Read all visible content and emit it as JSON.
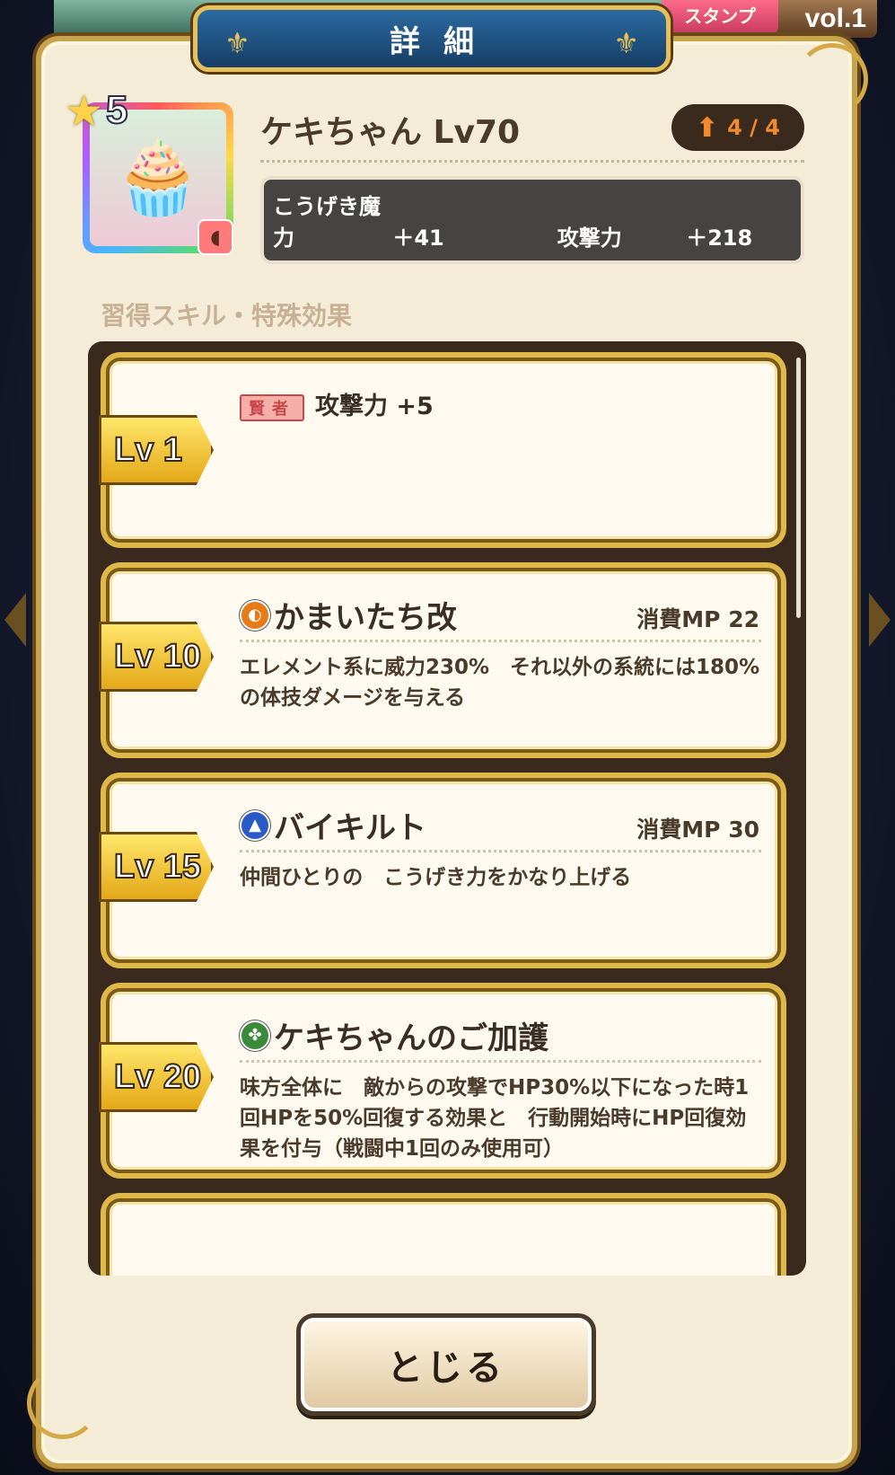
{
  "header": {
    "title": "詳細",
    "vol_label": "vol.",
    "vol_number": "1",
    "stamp_label": "スタンプ"
  },
  "monster": {
    "rank": "5",
    "name": "ケキちゃん Lv70",
    "upgrade_progress": "4 / 4",
    "stats": [
      {
        "label": "こうげき魔力",
        "value": "＋41"
      },
      {
        "label": "攻撃力",
        "value": "＋218"
      }
    ]
  },
  "section_title": "習得スキル・特殊効果",
  "skills": [
    {
      "level": "Lv 1",
      "tag": "賢者",
      "text": "攻撃力 +5"
    },
    {
      "level": "Lv 10",
      "icon": "fire-element-icon",
      "name": "かまいたち改",
      "mp": "消費MP  22",
      "description": "エレメント系に威力230%　それ以外の系統には180%の体技ダメージを与える"
    },
    {
      "level": "Lv 15",
      "icon": "buff-element-icon",
      "name": "バイキルト",
      "mp": "消費MP  30",
      "description": "仲間ひとりの　こうげき力をかなり上げる"
    },
    {
      "level": "Lv 20",
      "icon": "heal-element-icon",
      "name": "ケキちゃんのご加護",
      "mp": "",
      "description": "味方全体に　敵からの攻撃でHP30%以下になった時1回HPを50%回復する効果と　行動開始時にHP回復効果を付与（戦闘中1回のみ使用可）"
    }
  ],
  "close_button": "とじる"
}
